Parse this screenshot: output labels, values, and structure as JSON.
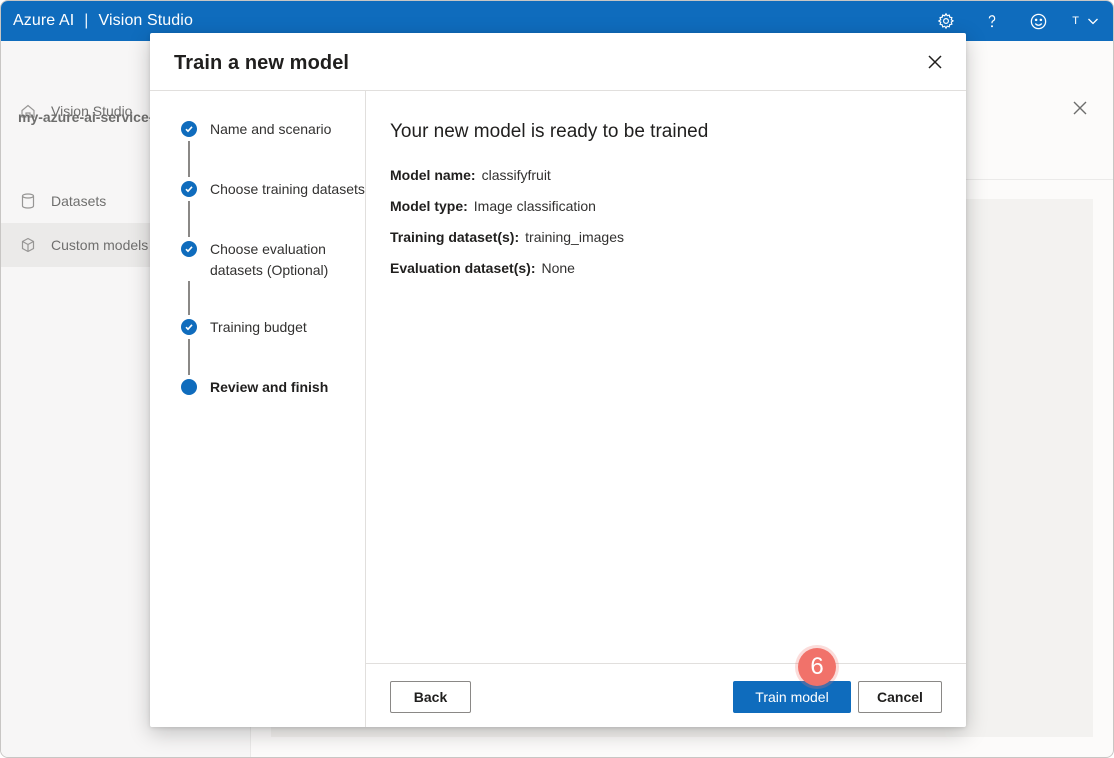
{
  "app": {
    "brand": "Azure AI",
    "separator": "|",
    "product": "Vision Studio",
    "user_initial": "T"
  },
  "background": {
    "nav_home": "Vision Studio",
    "resource_name": "my-azure-ai-service-",
    "nav_items": [
      {
        "label": "Datasets",
        "icon": "database-icon"
      },
      {
        "label": "Custom models",
        "icon": "cube-icon"
      }
    ]
  },
  "dialog": {
    "title": "Train a new model",
    "steps": [
      {
        "label": "Name and scenario",
        "state": "complete"
      },
      {
        "label": "Choose training datasets",
        "state": "complete"
      },
      {
        "label": "Choose evaluation datasets (Optional)",
        "state": "complete"
      },
      {
        "label": "Training budget",
        "state": "complete"
      },
      {
        "label": "Review and finish",
        "state": "current"
      }
    ],
    "heading": "Your new model is ready to be trained",
    "summary": [
      {
        "key": "Model name:",
        "value": "classifyfruit"
      },
      {
        "key": "Model type:",
        "value": "Image classification"
      },
      {
        "key": "Training dataset(s):",
        "value": "training_images"
      },
      {
        "key": "Evaluation dataset(s):",
        "value": "None"
      }
    ],
    "buttons": {
      "back": "Back",
      "train": "Train model",
      "cancel": "Cancel"
    }
  },
  "annotation": {
    "callout_number": "6",
    "callout_color": "#f1726a"
  },
  "colors": {
    "accent": "#0f6cbd"
  }
}
